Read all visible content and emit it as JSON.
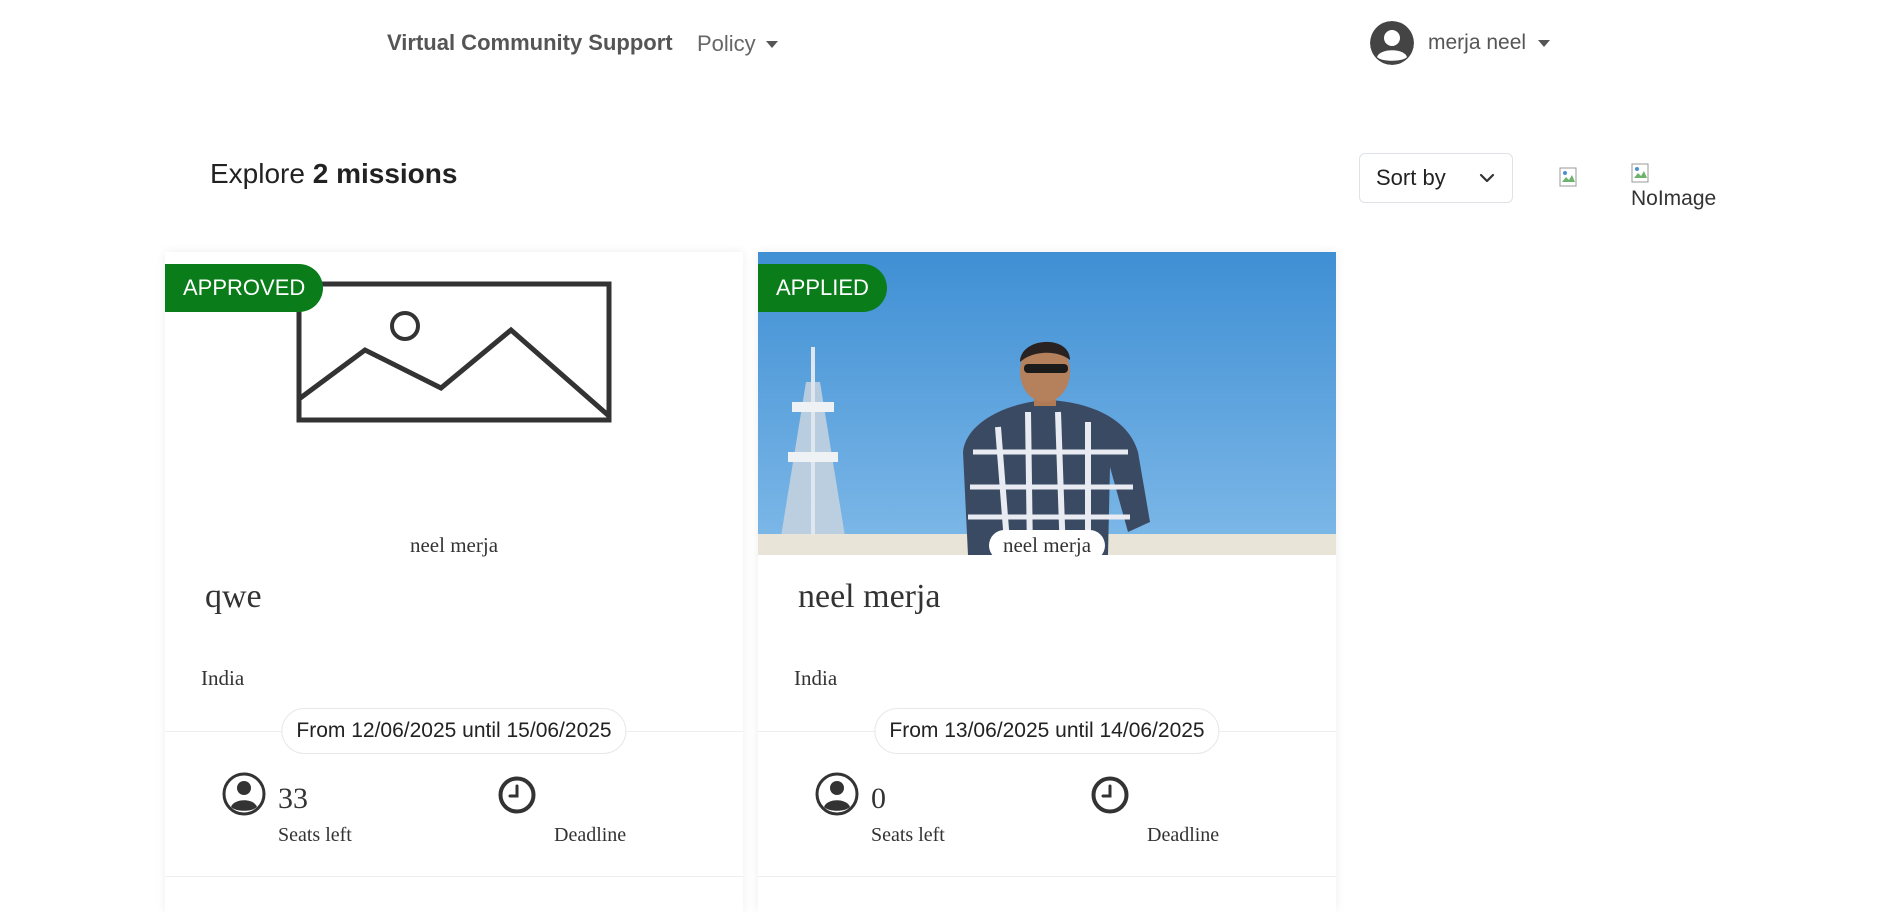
{
  "navbar": {
    "brand": "Virtual Community Support",
    "policy_label": "Policy",
    "user_name": "merja neel"
  },
  "toolbar": {
    "explore_prefix": "Explore",
    "explore_count": "2 missions",
    "sort_label": "Sort by",
    "list_view_alt": "NoImage"
  },
  "missions": [
    {
      "status": "APPROVED",
      "image": "no-image-placeholder",
      "author": "neel merja",
      "title": "qwe",
      "country": "India",
      "date_range": "From 12/06/2025 until 15/06/2025",
      "seats": "33",
      "seats_label": "Seats left",
      "deadline_label": "Deadline"
    },
    {
      "status": "APPLIED",
      "image": "photo-man-in-plaid-shirt",
      "author": "neel merja",
      "title": "neel merja",
      "country": "India",
      "date_range": "From 13/06/2025 until 14/06/2025",
      "seats": "0",
      "seats_label": "Seats left",
      "deadline_label": "Deadline"
    }
  ],
  "colors": {
    "badge_green": "#0a7d1a",
    "sky_blue": "#4a96d8"
  }
}
